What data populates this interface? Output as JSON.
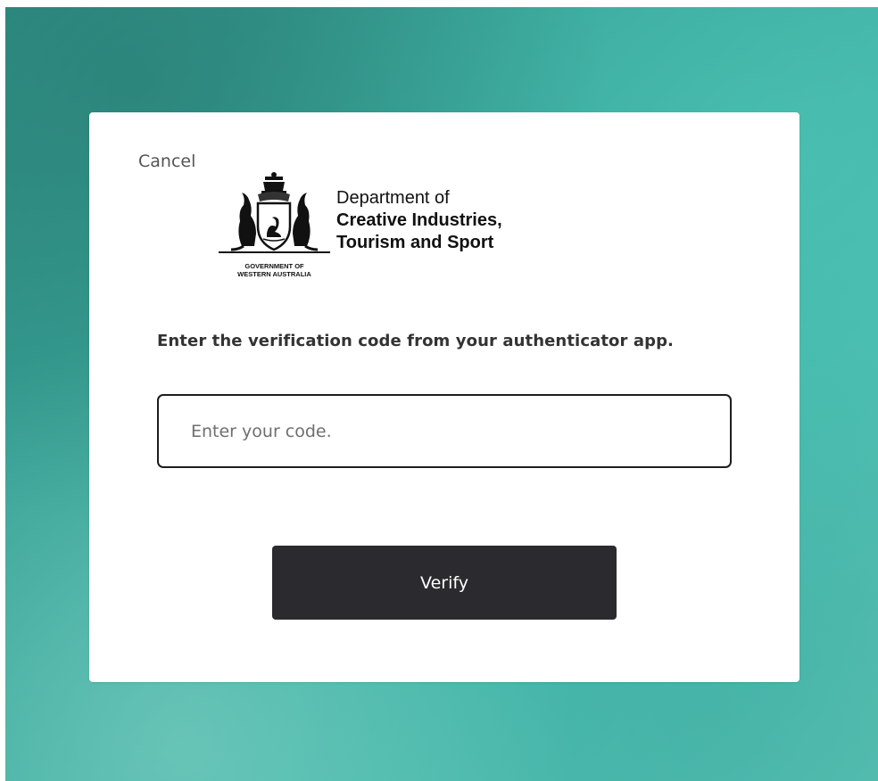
{
  "card": {
    "cancel_label": "Cancel",
    "logo": {
      "gov_line1": "GOVERNMENT OF",
      "gov_line2": "WESTERN AUSTRALIA",
      "dept_line1": "Department of",
      "dept_line2": "Creative Industries,",
      "dept_line3": "Tourism and Sport"
    },
    "instruction": "Enter the verification code from your authenticator app.",
    "code_input": {
      "placeholder": "Enter your code.",
      "value": ""
    },
    "verify_label": "Verify"
  },
  "colors": {
    "background_accent": "#3aa89c",
    "button_bg": "#2b2b2f",
    "button_text": "#ffffff",
    "input_border": "#1d1d1d"
  },
  "icons": {
    "crest": "wa-coat-of-arms-icon"
  }
}
